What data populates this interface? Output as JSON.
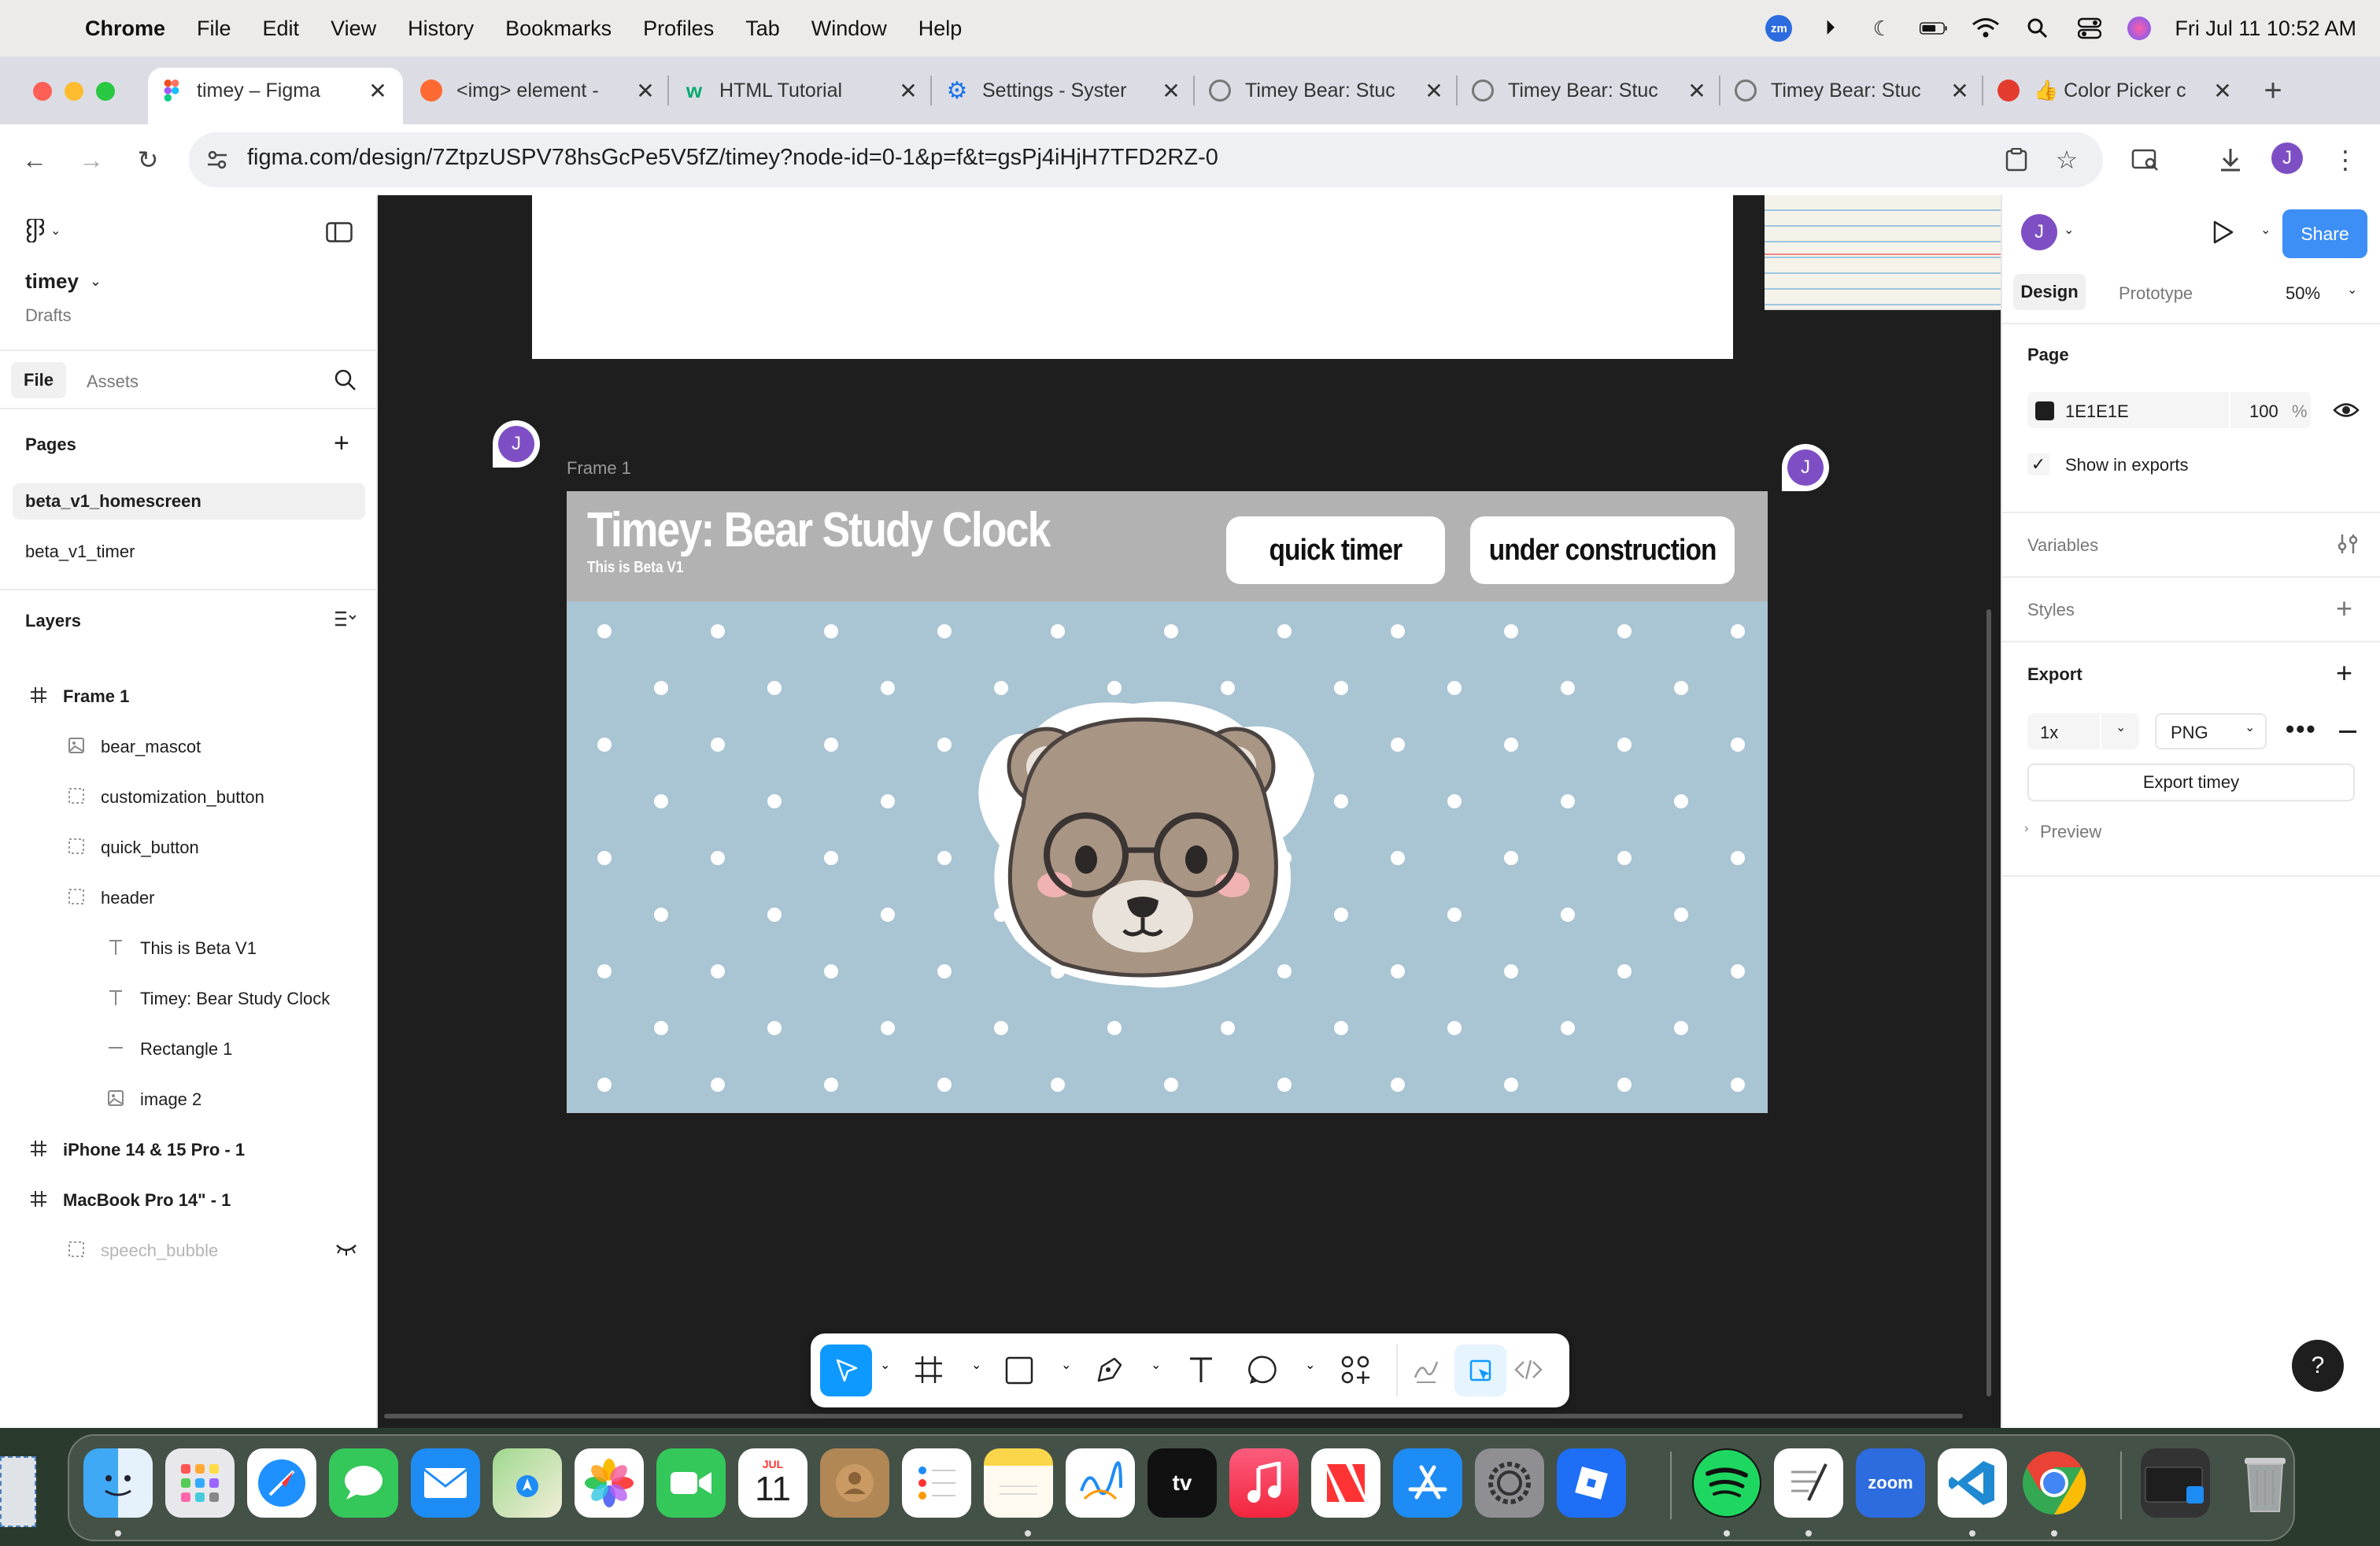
{
  "menubar": {
    "app_name": "Chrome",
    "menus": [
      "File",
      "Edit",
      "View",
      "History",
      "Bookmarks",
      "Profiles",
      "Tab",
      "Window",
      "Help"
    ],
    "zoom_badge": "zm",
    "clock": "Fri Jul 11  10:52 AM"
  },
  "tabs": [
    {
      "title": "timey – Figma",
      "icon": "figma-icon",
      "color": "#f24e1e",
      "active": true
    },
    {
      "title": "<img> element -",
      "icon": "mdn-icon",
      "color": "#ff6a33"
    },
    {
      "title": "HTML Tutorial",
      "icon": "w3schools-icon",
      "color": "#04aa6d"
    },
    {
      "title": "Settings - Syster",
      "icon": "gear-icon",
      "color": "#1a73e8"
    },
    {
      "title": "Timey Bear: Stuc",
      "icon": "globe-icon",
      "color": "#777777"
    },
    {
      "title": "Timey Bear: Stuc",
      "icon": "globe-icon",
      "color": "#777777"
    },
    {
      "title": "Timey Bear: Stuc",
      "icon": "globe-icon",
      "color": "#777777"
    },
    {
      "title": "👍 Color Picker c",
      "icon": "color-picker-icon",
      "color": "#e33b2e"
    }
  ],
  "address": {
    "url": "figma.com/design/7ZtpzUSPV78hsGcPe5V5fZ/timey?node-id=0-1&p=f&t=gsPj4iHjH7TFD2RZ-0"
  },
  "profile_initial": "J",
  "left_panel": {
    "file_name": "timey",
    "file_location": "Drafts",
    "tabs": [
      "File",
      "Assets"
    ],
    "pages_title": "Pages",
    "pages": [
      "beta_v1_homescreen",
      "beta_v1_timer"
    ],
    "layers_title": "Layers",
    "layers": [
      {
        "name": "Frame 1",
        "icon": "frame-icon",
        "level": 0,
        "bold": true
      },
      {
        "name": "bear_mascot",
        "icon": "image-icon",
        "level": 1
      },
      {
        "name": "customization_button",
        "icon": "dashed-frame-icon",
        "level": 1
      },
      {
        "name": "quick_button",
        "icon": "dashed-frame-icon",
        "level": 1
      },
      {
        "name": "header",
        "icon": "dashed-frame-icon",
        "level": 1
      },
      {
        "name": "This is Beta V1",
        "icon": "text-icon",
        "level": 2
      },
      {
        "name": "Timey: Bear Study Clock",
        "icon": "text-icon",
        "level": 2
      },
      {
        "name": "Rectangle 1",
        "icon": "line-icon",
        "level": 2
      },
      {
        "name": "image 2",
        "icon": "image-icon",
        "level": 2
      },
      {
        "name": "iPhone 14 & 15 Pro - 1",
        "icon": "frame-icon",
        "level": 0,
        "bold": true
      },
      {
        "name": "MacBook Pro 14\" - 1",
        "icon": "frame-icon",
        "level": 0,
        "bold": true
      },
      {
        "name": "speech_bubble",
        "icon": "dashed-frame-icon",
        "level": 1,
        "hidden": true
      }
    ]
  },
  "canvas": {
    "frame_label": "Frame 1",
    "cursor_initial": "J",
    "header_title": "Timey: Bear Study Clock",
    "header_subtitle": "This is Beta V1",
    "quick_button": "quick timer",
    "construction_button": "under construction"
  },
  "bottom_toolbar": {
    "tools": [
      "move-icon",
      "frame-icon",
      "rectangle-icon",
      "pen-icon",
      "text-icon",
      "comment-icon",
      "actions-icon"
    ],
    "modes": [
      "draw-icon",
      "design-mode-icon",
      "dev-mode-icon"
    ]
  },
  "right_panel": {
    "share_label": "Share",
    "tabs": [
      "Design",
      "Prototype"
    ],
    "zoom": "50%",
    "page_title": "Page",
    "page_color": "1E1E1E",
    "page_opacity": "100",
    "percent": "%",
    "show_in_exports": "Show in exports",
    "variables": "Variables",
    "styles": "Styles",
    "export": "Export",
    "export_scale": "1x",
    "export_format": "PNG",
    "export_button": "Export timey",
    "preview": "Preview",
    "help": "?"
  },
  "dock": {
    "calendar_month": "JUL",
    "calendar_day": "11",
    "tv_label": "tv",
    "zoom_label": "zoom"
  },
  "colors": {
    "figma_blue": "#0d99ff",
    "share_blue": "#3d8ef5",
    "avatar_purple": "#7e4fc4",
    "canvas_bg": "#1e1e1e",
    "header_gray": "#b2b2b2",
    "dots_blue": "#a9c4d3"
  }
}
